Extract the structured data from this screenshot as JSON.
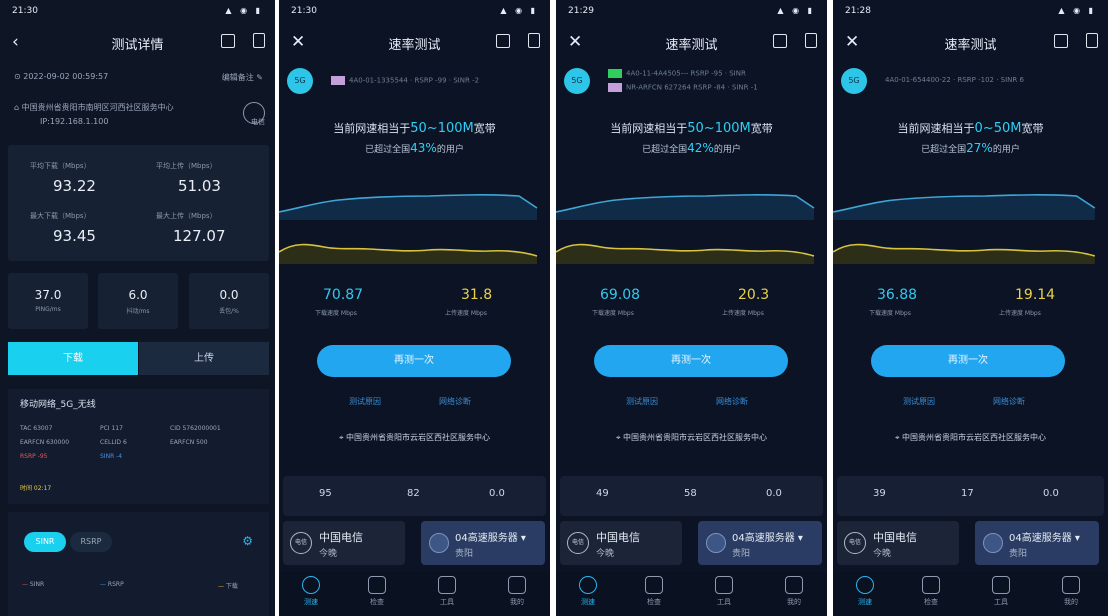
{
  "panel1": {
    "status_time": "21:30",
    "title": "测试详情",
    "date": "2022-09-02 00:59:57",
    "note_label": "编辑备注",
    "network_line": "中国贵州省贵阳市南明区河西社区服务中心",
    "ip": "IP:192.168.1.100",
    "disk_label": "电信",
    "stats": {
      "avg_dl_label": "平均下载（Mbps）",
      "avg_dl": "93.22",
      "avg_ul_label": "平均上传（Mbps）",
      "avg_ul": "51.03",
      "max_dl_label": "最大下载（Mbps）",
      "max_dl": "93.45",
      "max_ul_label": "最大上传（Mbps）",
      "max_ul": "127.07"
    },
    "cards": [
      {
        "value": "37.0",
        "label": "PING/ms"
      },
      {
        "value": "6.0",
        "label": "抖动/ms"
      },
      {
        "value": "0.0",
        "label": "丢包/%"
      }
    ],
    "tabs": [
      "下载",
      "上传"
    ],
    "cell_header": "移动网络_5G_无线",
    "cell_kv": [
      "TAC  63007",
      "PCI  117",
      "CID  5762000001",
      "EARFCN  630000",
      "CELLID  6",
      "EARFCN  500",
      "RSRP  -95",
      "SINR  -4"
    ],
    "cell_time": "时间  02:17",
    "pills": [
      "SINR",
      "RSRP"
    ],
    "legend": [
      "SINR",
      "RSRP",
      "下载"
    ]
  },
  "tests": [
    {
      "time": "21:30",
      "title": "速率测试",
      "mode": "5G",
      "bands": [
        {
          "text": "4A0-01-1335544 · RSRP -99 · SINR -2",
          "color": "#c49fd9"
        }
      ],
      "speed_prefix": "当前网速相当于",
      "speed_range": "50~100M",
      "speed_suffix": "宽带",
      "beat_prefix": "已超过全国",
      "beat_pct": "43%",
      "beat_suffix": "的用户",
      "dl": "70.87",
      "ul": "31.8",
      "dl_label": "下载速度 Mbps",
      "ul_label": "上传速度 Mbps",
      "again": "再测一次",
      "link1": "测试原因",
      "link2": "网络诊断",
      "location": "中国贵州省贵阳市云岩区西社区服务中心",
      "bottom": [
        "95",
        "82",
        "0.0"
      ],
      "operator": "中国电信",
      "op_sub": "今晚",
      "op_icon": "电信",
      "server": "04高速服务器",
      "server_sub": "贵阳"
    },
    {
      "time": "21:29",
      "title": "速率测试",
      "mode": "5G",
      "bands": [
        {
          "text": "4A0-11-4A4505--- RSRP -95 · SINR",
          "color": "#2ecf5a"
        },
        {
          "text": "NR-ARFCN 627264 RSRP -84 · SINR -1",
          "color": "#c49fd9"
        }
      ],
      "speed_prefix": "当前网速相当于",
      "speed_range": "50~100M",
      "speed_suffix": "宽带",
      "beat_prefix": "已超过全国",
      "beat_pct": "42%",
      "beat_suffix": "的用户",
      "dl": "69.08",
      "ul": "20.3",
      "dl_label": "下载速度 Mbps",
      "ul_label": "上传速度 Mbps",
      "again": "再测一次",
      "link1": "测试原因",
      "link2": "网络诊断",
      "location": "中国贵州省贵阳市云岩区西社区服务中心",
      "bottom": [
        "49",
        "58",
        "0.0"
      ],
      "operator": "中国电信",
      "op_sub": "今晚",
      "op_icon": "电信",
      "server": "04高速服务器",
      "server_sub": "贵阳"
    },
    {
      "time": "21:28",
      "title": "速率测试",
      "mode": "5G",
      "bands": [
        {
          "text": "4A0-01-654400-22 · RSRP -102 · SINR 6",
          "color": ""
        }
      ],
      "speed_prefix": "当前网速相当于",
      "speed_range": "0~50M",
      "speed_suffix": "宽带",
      "beat_prefix": "已超过全国",
      "beat_pct": "27%",
      "beat_suffix": "的用户",
      "dl": "36.88",
      "ul": "19.14",
      "dl_label": "下载速度 Mbps",
      "ul_label": "上传速度 Mbps",
      "again": "再测一次",
      "link1": "测试原因",
      "link2": "网络诊断",
      "location": "中国贵州省贵阳市云岩区西社区服务中心",
      "bottom": [
        "39",
        "17",
        "0.0"
      ],
      "operator": "中国电信",
      "op_sub": "今晚",
      "op_icon": "电信",
      "server": "04高速服务器",
      "server_sub": "贵阳"
    }
  ],
  "tabbar": [
    "测速",
    "检查",
    "工具",
    "我的"
  ],
  "colors": {
    "accent": "#2ab4f0",
    "download": "#34c8ef",
    "upload": "#e9d24a",
    "bg": "#0b1324"
  }
}
